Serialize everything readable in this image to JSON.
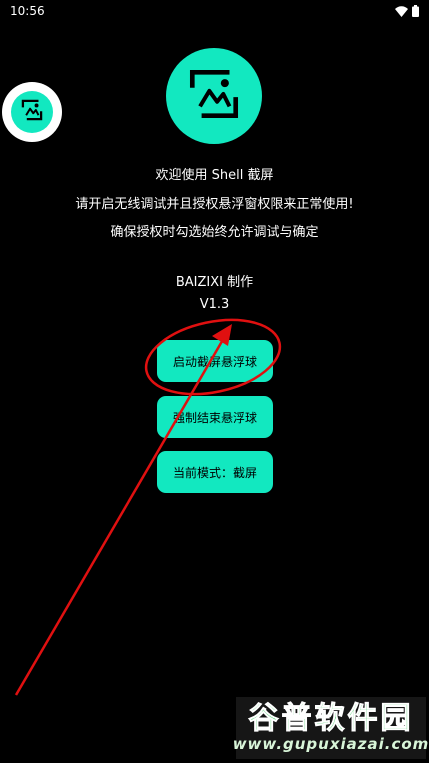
{
  "status_bar": {
    "time": "10:56"
  },
  "colors": {
    "accent": "#12e8c0",
    "background": "#000000",
    "annotation": "#e01010",
    "watermark_green": "#2dc653"
  },
  "icons": {
    "app_logo": "image-gallery-icon",
    "floating_bubble": "image-gallery-icon"
  },
  "main": {
    "welcome": "欢迎使用 Shell 截屏",
    "instruction_1": "请开启无线调试并且授权悬浮窗权限来正常使用!",
    "instruction_2": "确保授权时勾选始终允许调试与确定",
    "author": "BAIZIXI 制作",
    "version": "V1.3"
  },
  "buttons": {
    "start_bubble": "启动截屏悬浮球",
    "stop_bubble": "强制结束悬浮球",
    "mode": "当前模式：截屏"
  },
  "watermark": {
    "title": "谷普软件园",
    "url": "www.gupuxiazai.com"
  }
}
